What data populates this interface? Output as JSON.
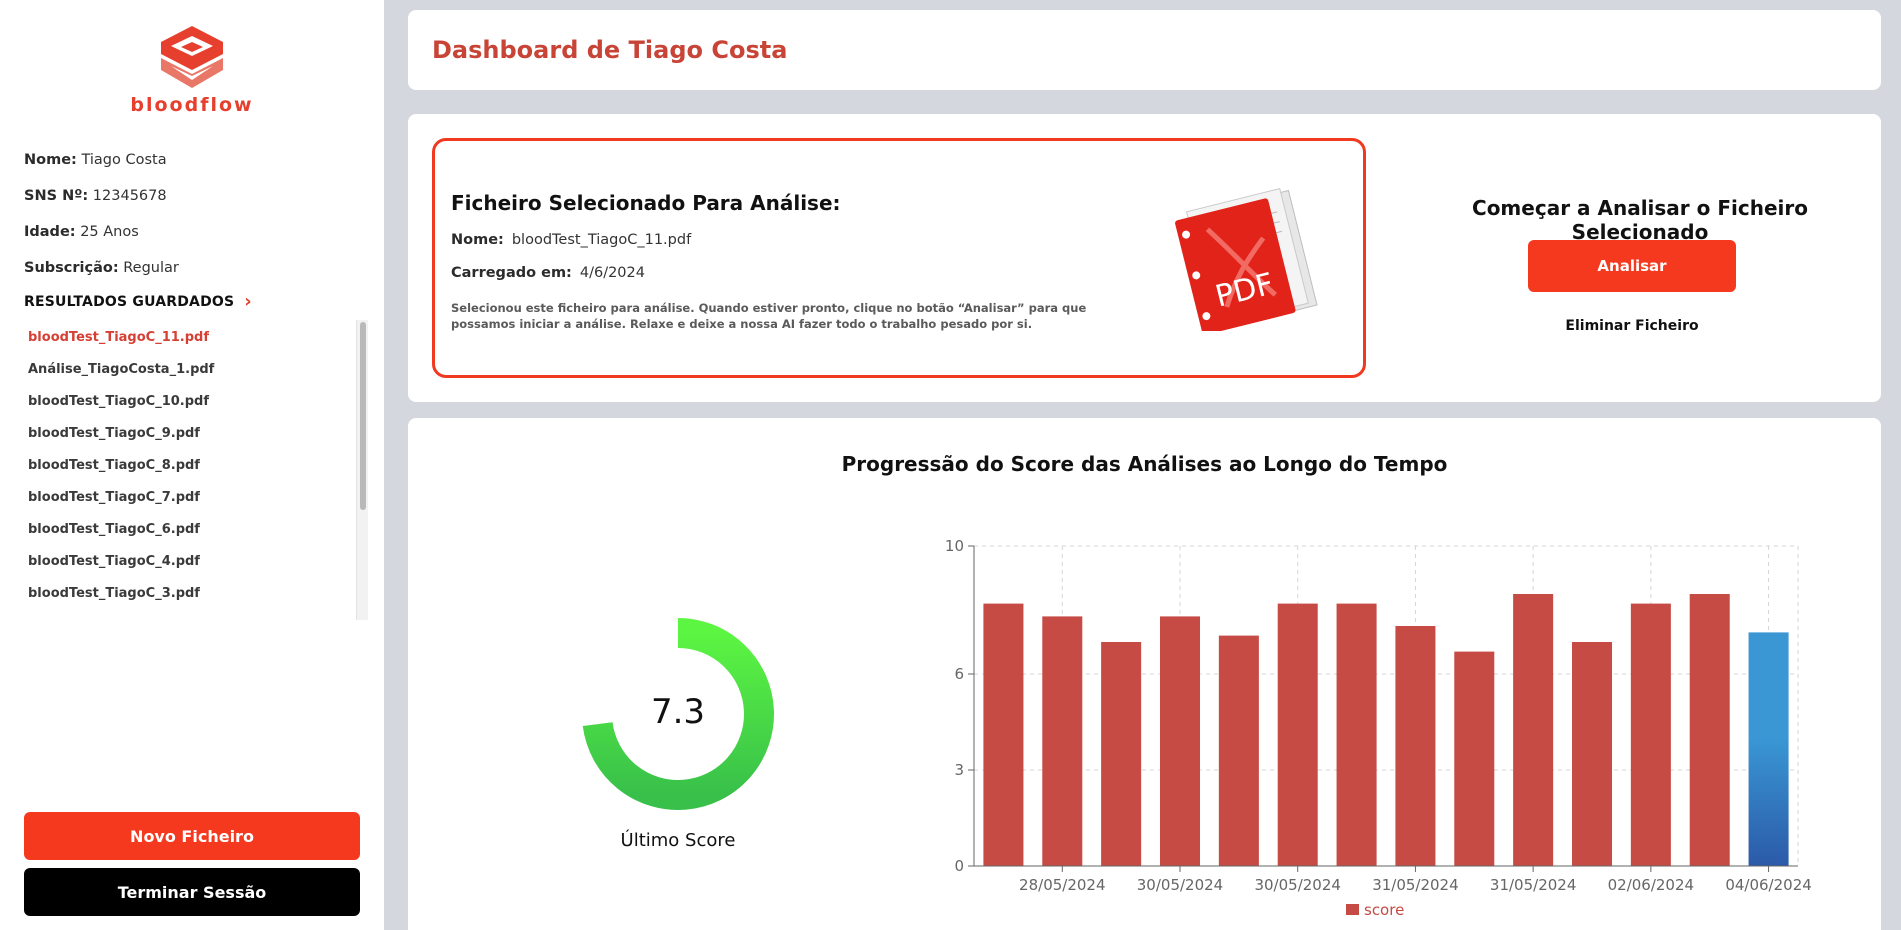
{
  "app": {
    "name": "bloodflow",
    "accent": "#e63f2e"
  },
  "profile": [
    {
      "label": "Nome:",
      "value": "Tiago Costa"
    },
    {
      "label": "SNS Nº:",
      "value": "12345678"
    },
    {
      "label": "Idade:",
      "value": "25 Anos"
    },
    {
      "label": "Subscrição:",
      "value": "Regular"
    }
  ],
  "saved": {
    "title": "RESULTADOS GUARDADOS",
    "files": [
      "bloodTest_TiagoC_11.pdf",
      "Análise_TiagoCosta_1.pdf",
      "bloodTest_TiagoC_10.pdf",
      "bloodTest_TiagoC_9.pdf",
      "bloodTest_TiagoC_8.pdf",
      "bloodTest_TiagoC_7.pdf",
      "bloodTest_TiagoC_6.pdf",
      "bloodTest_TiagoC_4.pdf",
      "bloodTest_TiagoC_3.pdf"
    ]
  },
  "buttons": {
    "new_file": "Novo Ficheiro",
    "end_session": "Terminar Sessão"
  },
  "header": {
    "title": "Dashboard de Tiago Costa"
  },
  "selected_file": {
    "title": "Ficheiro Selecionado Para Análise:",
    "name_label": "Nome:",
    "name": "bloodTest_TiagoC_11.pdf",
    "uploaded_label": "Carregado em:",
    "uploaded": "4/6/2024",
    "description": "Selecionou este ficheiro para análise. Quando estiver pronto, clique no botão “Analisar” para que possamos iniciar a análise. Relaxe e deixe a nossa AI fazer todo o trabalho pesado por si.",
    "icon_text": "PDF"
  },
  "analysis": {
    "title": "Começar a Analisar o Ficheiro Selecionado",
    "analyze_button": "Analisar",
    "delete_link": "Eliminar Ficheiro"
  },
  "gauge": {
    "value": "7.3",
    "fraction": 0.73,
    "label": "Último Score"
  },
  "chart_data": {
    "type": "bar",
    "title": "Progressão do Score das Análises ao Longo do Tempo",
    "categories": [
      "",
      "28/05/2024",
      "",
      "30/05/2024",
      "",
      "30/05/2024",
      "",
      "31/05/2024",
      "",
      "31/05/2024",
      "",
      "02/06/2024",
      "",
      "04/06/2024"
    ],
    "values": [
      8.2,
      7.8,
      7.0,
      7.8,
      7.2,
      8.2,
      8.2,
      7.5,
      6.7,
      8.5,
      7.0,
      8.2,
      8.5,
      7.3
    ],
    "y_ticks": [
      0,
      3,
      6,
      10
    ],
    "ylim": [
      0,
      10
    ],
    "highlight_index": 13,
    "colors": {
      "bar": "#c64b45",
      "highlight": "#3a97d4"
    },
    "legend": "score",
    "legend_position": "bottom",
    "grid": true
  }
}
